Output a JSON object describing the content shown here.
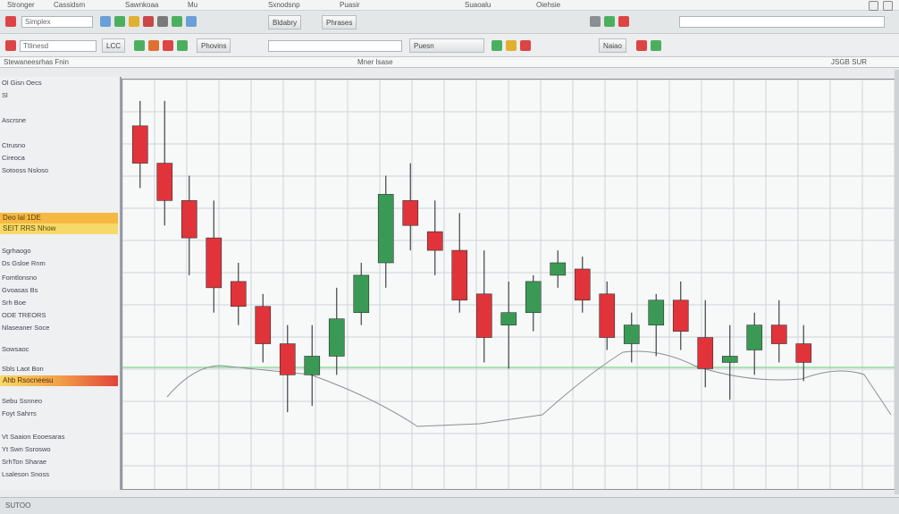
{
  "menubar": {
    "items": [
      "Stronger",
      "Cassidsm",
      "Sawnkoaa",
      "Mu",
      "Sxnodsnp",
      "Puasir",
      "Suaoalu",
      "Oiehsie"
    ]
  },
  "toolbar1": {
    "field_value": "Simplex",
    "buttons": [
      "Bldabry",
      "Phrases"
    ]
  },
  "toolbar2": {
    "field_value": "Ttlinesd",
    "buttons": [
      "LCC",
      "Phovins",
      "Puesn",
      "Naiao"
    ]
  },
  "infobar": {
    "left_text": "Stewaneesrhas Fnin",
    "center_text": "Mner Isase",
    "right_text": "JSGB  SUR"
  },
  "sidebar": {
    "rows_top": [
      "Ol Gisn  Oecs",
      "Sl",
      "Ascrsne",
      "Ctrusno",
      "Cireoca",
      "Sotooss  Nsloso"
    ],
    "highlight1": "Deo lal  1DE",
    "highlight2": "SEIT  RRS Nhow",
    "rows_mid": [
      "Sgrhaogo",
      "Ds Gsloe  Rnm",
      "Fomtlonsno",
      "Gvoasas  Bs",
      "Srh  Boe",
      "ODE TREORS",
      "Nlaseaner Soce",
      "Sowsaoc",
      "Sbls  Laot Bon"
    ],
    "highlight3": "Ahb  Rsocneesu",
    "rows_low": [
      "Sebu Ssnneo",
      "Foyt Sahrrs"
    ],
    "bottom": [
      "Vt Saaion  Eooesaras",
      "Yt Swn  Ssroswo",
      "SrhTon  Sharae",
      "Lsaleson Snoss"
    ]
  },
  "statusbar": {
    "text": "SUTOO"
  },
  "colors": {
    "up": "#3a9a55",
    "down": "#e0343a",
    "grid": "#cfd4d7",
    "wick": "#3f4448",
    "indicator": "#7fd58a"
  },
  "chart_data": {
    "type": "candlestick",
    "candles": [
      {
        "o": 300,
        "h": 320,
        "l": 250,
        "c": 270
      },
      {
        "o": 270,
        "h": 320,
        "l": 220,
        "c": 240
      },
      {
        "o": 240,
        "h": 260,
        "l": 180,
        "c": 210
      },
      {
        "o": 210,
        "h": 240,
        "l": 150,
        "c": 170
      },
      {
        "o": 175,
        "h": 190,
        "l": 140,
        "c": 155
      },
      {
        "o": 155,
        "h": 165,
        "l": 110,
        "c": 125
      },
      {
        "o": 125,
        "h": 140,
        "l": 70,
        "c": 100
      },
      {
        "o": 100,
        "h": 140,
        "l": 75,
        "c": 115
      },
      {
        "o": 115,
        "h": 170,
        "l": 100,
        "c": 145
      },
      {
        "o": 150,
        "h": 190,
        "l": 140,
        "c": 180
      },
      {
        "o": 190,
        "h": 260,
        "l": 170,
        "c": 245
      },
      {
        "o": 240,
        "h": 270,
        "l": 200,
        "c": 220
      },
      {
        "o": 215,
        "h": 240,
        "l": 180,
        "c": 200
      },
      {
        "o": 200,
        "h": 230,
        "l": 150,
        "c": 160
      },
      {
        "o": 165,
        "h": 200,
        "l": 110,
        "c": 130
      },
      {
        "o": 140,
        "h": 175,
        "l": 105,
        "c": 150
      },
      {
        "o": 150,
        "h": 180,
        "l": 135,
        "c": 175
      },
      {
        "o": 180,
        "h": 200,
        "l": 170,
        "c": 190
      },
      {
        "o": 185,
        "h": 195,
        "l": 150,
        "c": 160
      },
      {
        "o": 165,
        "h": 175,
        "l": 120,
        "c": 130
      },
      {
        "o": 125,
        "h": 150,
        "l": 110,
        "c": 140
      },
      {
        "o": 140,
        "h": 165,
        "l": 115,
        "c": 160
      },
      {
        "o": 160,
        "h": 175,
        "l": 120,
        "c": 135
      },
      {
        "o": 130,
        "h": 160,
        "l": 90,
        "c": 105
      },
      {
        "o": 110,
        "h": 140,
        "l": 80,
        "c": 115
      },
      {
        "o": 120,
        "h": 150,
        "l": 100,
        "c": 140
      },
      {
        "o": 140,
        "h": 160,
        "l": 110,
        "c": 125
      },
      {
        "o": 125,
        "h": 140,
        "l": 95,
        "c": 110
      }
    ]
  }
}
